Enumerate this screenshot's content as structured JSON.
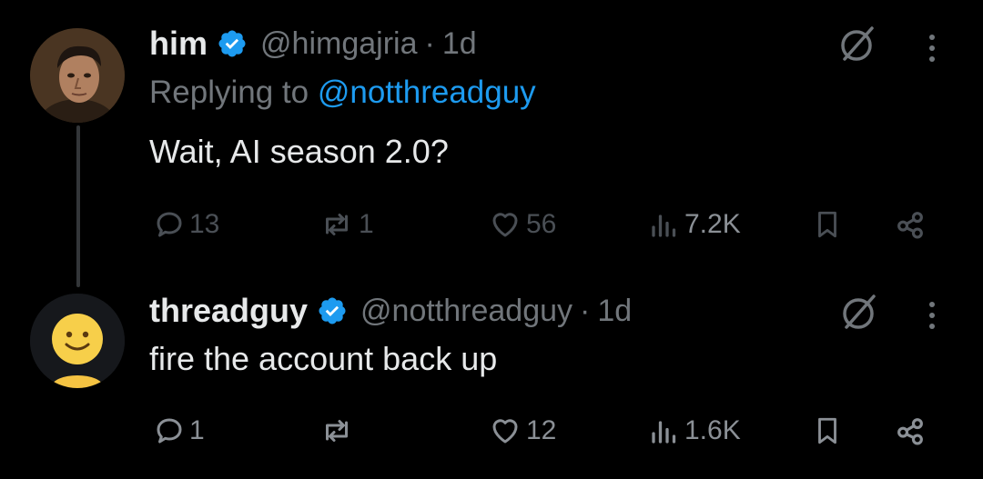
{
  "colors": {
    "background": "#000000",
    "text": "#e7e9ea",
    "muted": "#71767b",
    "link": "#1d9bf0",
    "verified": "#1d9bf0"
  },
  "tweets": [
    {
      "name": "him",
      "handle": "@himgajria",
      "separator": "·",
      "time": "1d",
      "replying_prefix": "Replying to ",
      "replying_to": "@notthreadguy",
      "text": "Wait, AI season 2.0?",
      "stats": {
        "replies": "13",
        "reposts": "1",
        "likes": "56",
        "views": "7.2K"
      },
      "icons": [
        "verified-badge-icon",
        "grok-icon",
        "more-icon",
        "reply-icon",
        "repost-icon",
        "like-icon",
        "views-icon",
        "bookmark-icon",
        "share-icon"
      ]
    },
    {
      "name": "threadguy",
      "handle": "@notthreadguy",
      "separator": "·",
      "time": "1d",
      "text": "fire the account back up",
      "stats": {
        "replies": "1",
        "reposts": "",
        "likes": "12",
        "views": "1.6K"
      },
      "icons": [
        "verified-badge-icon",
        "grok-icon",
        "more-icon",
        "reply-icon",
        "repost-icon",
        "like-icon",
        "views-icon",
        "bookmark-icon",
        "share-icon"
      ]
    }
  ]
}
